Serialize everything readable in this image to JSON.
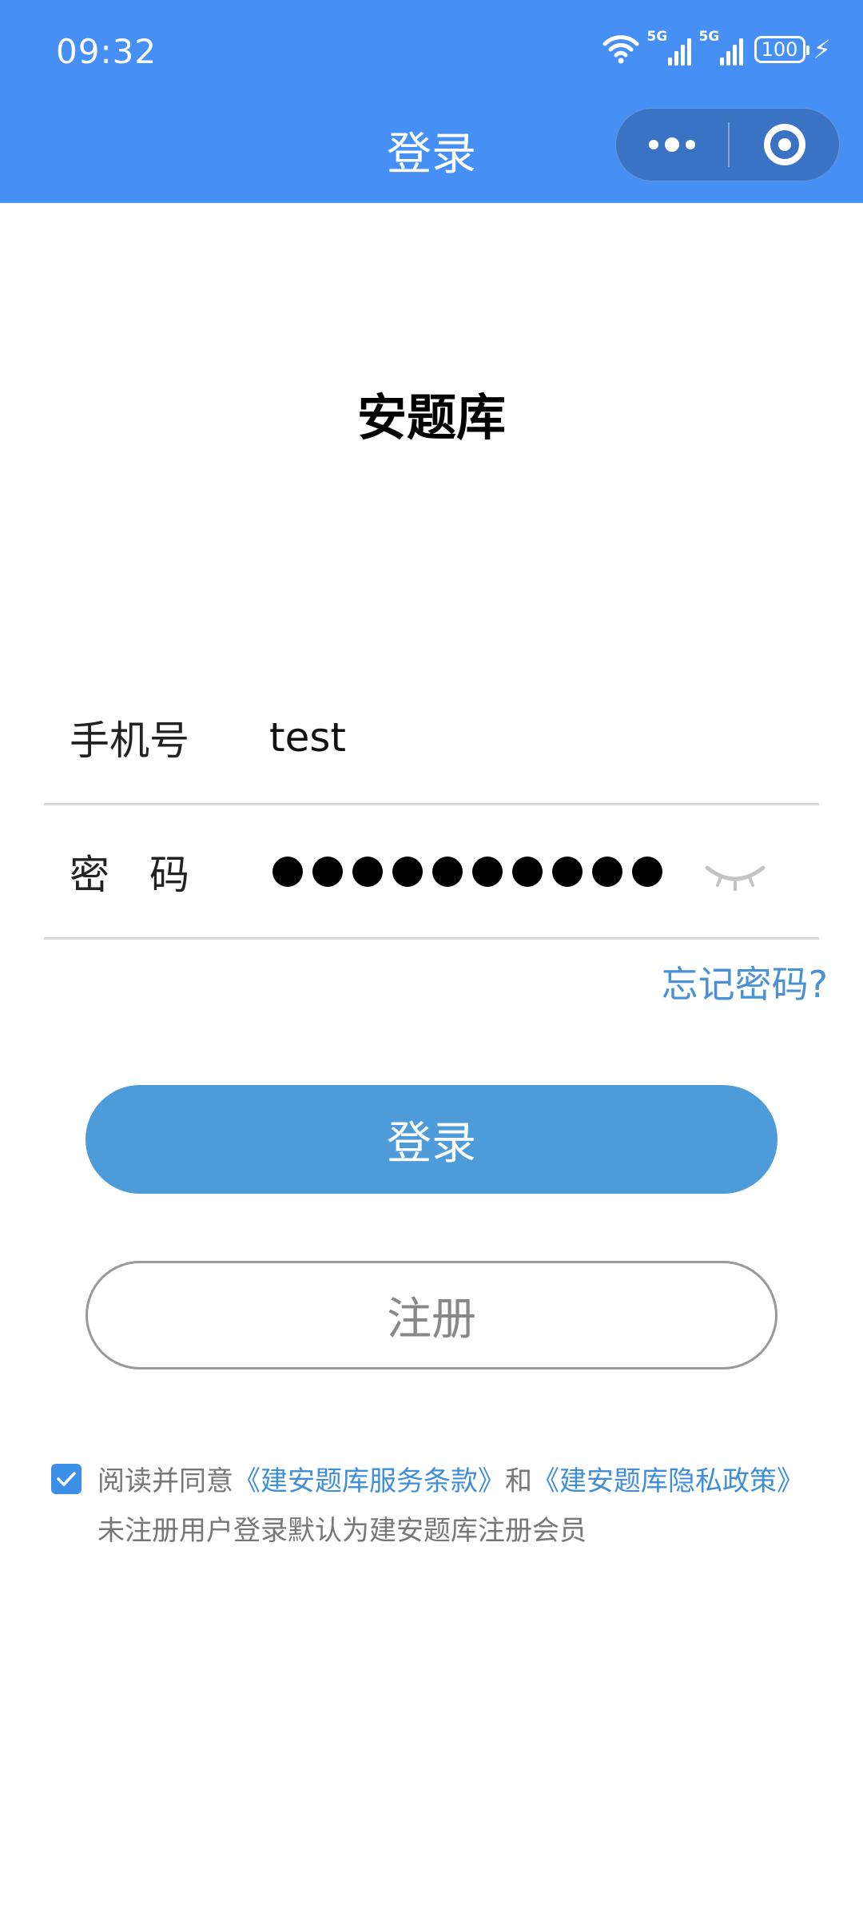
{
  "status_bar": {
    "time": "09:32",
    "network_1": "5G",
    "network_2": "5G",
    "battery": "100"
  },
  "nav": {
    "title": "登录"
  },
  "app": {
    "name": "安题库"
  },
  "form": {
    "phone_label": "手机号",
    "phone_value": "test",
    "password_label": "密　码",
    "forgot_password": "忘记密码?"
  },
  "buttons": {
    "login": "登录",
    "register": "注册"
  },
  "agreement": {
    "checked": true,
    "prefix": "阅读并同意",
    "terms_link": "《建安题库服务条款》",
    "and": "和",
    "privacy_link": "《建安题库隐私政策》",
    "note": "未注册用户登录默认为建安题库注册会员"
  },
  "colors": {
    "nav_background": "#468ff5",
    "login_button": "#4d9bd8",
    "link": "#3f8fd8"
  }
}
